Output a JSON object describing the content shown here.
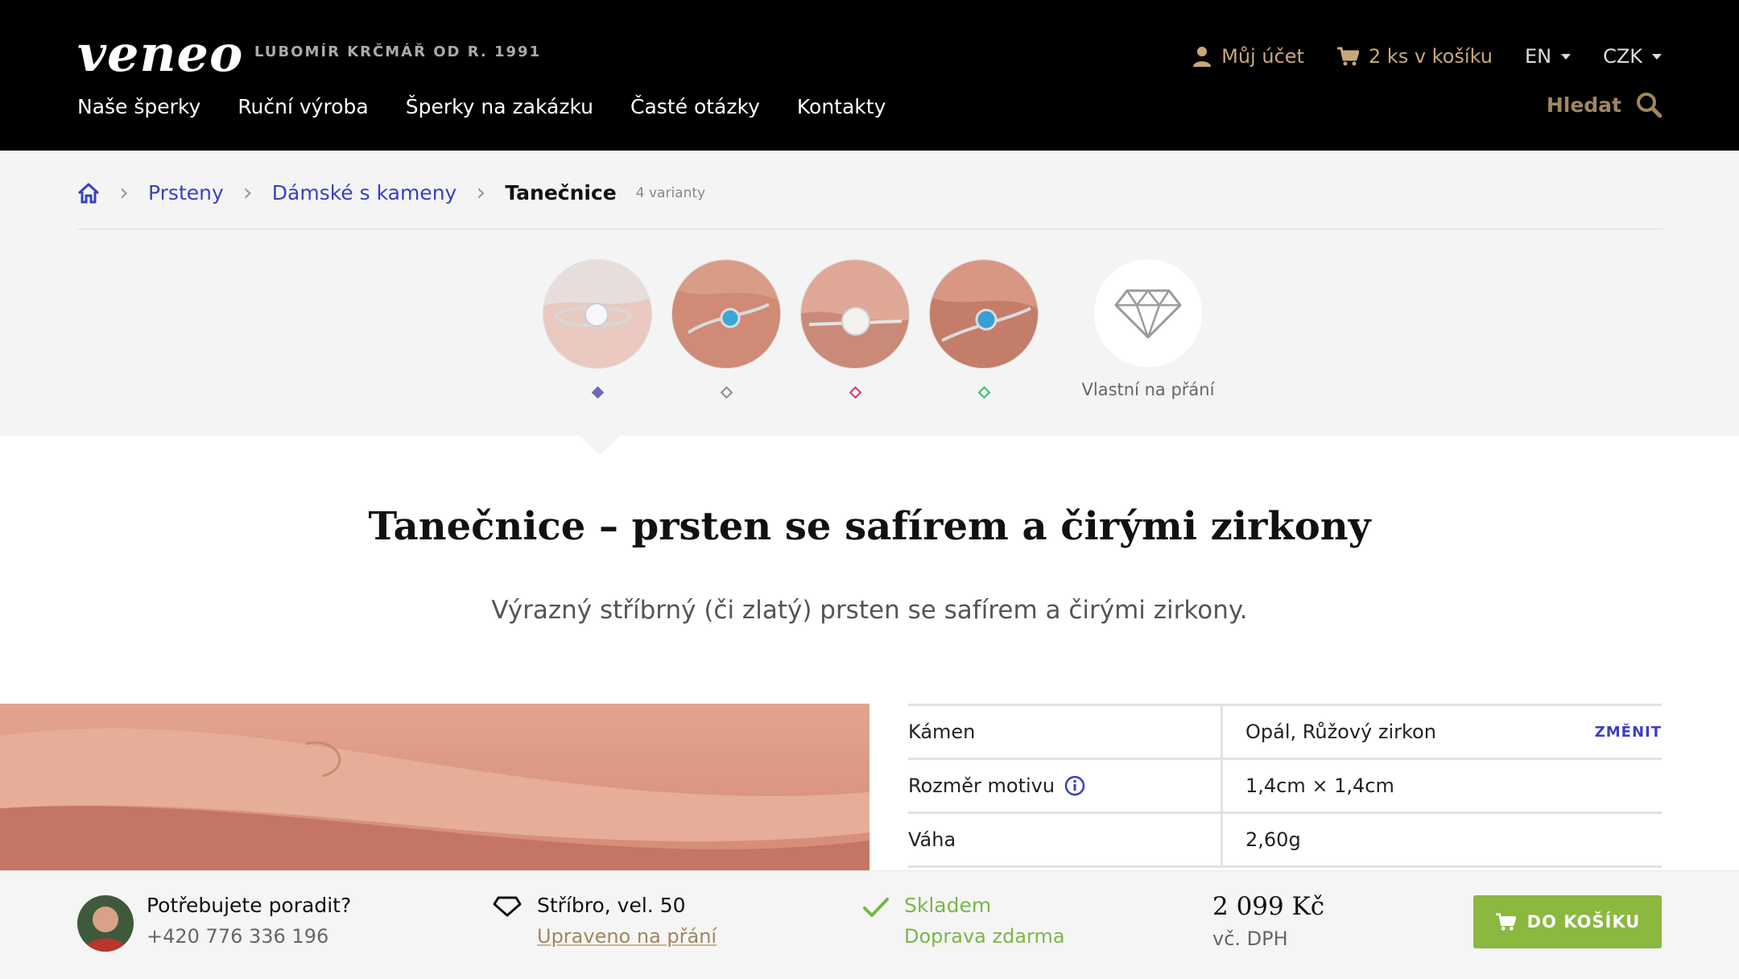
{
  "brand": {
    "logo": "veneo",
    "tagline": "LUBOMÍR KRČMÁŘ OD R. 1991"
  },
  "nav": [
    "Naše šperky",
    "Ruční výroba",
    "Šperky na zakázku",
    "Časté otázky",
    "Kontakty"
  ],
  "account": {
    "label": "Můj účet",
    "cart": "2 ks v košíku",
    "language": "EN",
    "currency": "CZK"
  },
  "search": {
    "label": "Hledat"
  },
  "breadcrumb": {
    "items": [
      "Prsteny",
      "Dámské s kameny"
    ],
    "current": "Tanečnice",
    "variants_note": "4 varianty"
  },
  "variants": {
    "items": [
      {
        "name": "variant-1",
        "color": "#6b6bb5"
      },
      {
        "name": "variant-2",
        "color": "#8a8a8a"
      },
      {
        "name": "variant-3",
        "color": "#d6306a"
      },
      {
        "name": "variant-4",
        "color": "#2fbf5f"
      }
    ],
    "custom_label": "Vlastní na přání"
  },
  "product": {
    "title": "Tanečnice – prsten se safírem a čirými zirkony",
    "subtitle": "Výrazný stříbrný (či zlatý) prsten se safírem a čirými zirkony."
  },
  "specs": {
    "change_label": "ZMĚNIT",
    "rows": [
      {
        "label": "Kámen",
        "value": "Opál, Růžový zirkon"
      },
      {
        "label": "Rozměr motivu",
        "value": "1,4cm × 1,4cm"
      },
      {
        "label": "Váha",
        "value": "2,60g"
      }
    ]
  },
  "bottom": {
    "help_title": "Potřebujete poradit?",
    "phone": "+420 776 336 196",
    "material": "Stříbro, vel. 50",
    "customized": "Upraveno na přání",
    "stock": "Skladem",
    "shipping": "Doprava zdarma",
    "price": "2 099 Kč",
    "vat": "vč. DPH",
    "cta": "DO KOŠÍKU"
  },
  "colors": {
    "accent": "#3b3fc0",
    "gold": "#c8a87a",
    "green": "#8bb83f",
    "stock_green": "#7ab648"
  }
}
